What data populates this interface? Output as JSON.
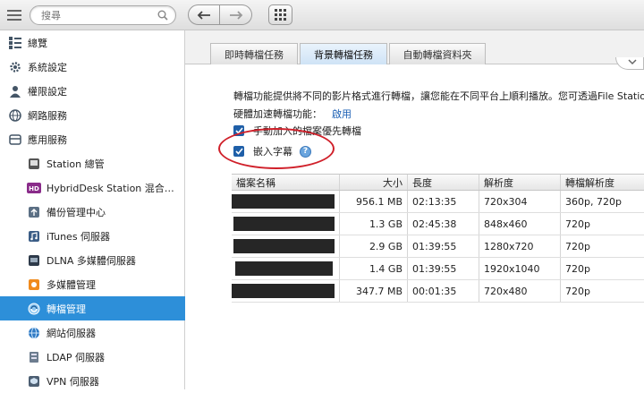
{
  "search": {
    "placeholder": "搜尋"
  },
  "sidebar": {
    "top_items": [
      {
        "label": "總覽",
        "icon": "overview-icon"
      },
      {
        "label": "系統設定",
        "icon": "gear-icon"
      },
      {
        "label": "權限設定",
        "icon": "user-icon"
      },
      {
        "label": "網路服務",
        "icon": "globe-icon"
      },
      {
        "label": "應用服務",
        "icon": "apps-icon"
      }
    ],
    "sub_items": [
      {
        "label": "Station 總管",
        "icon": "station-manager-icon"
      },
      {
        "label": "HybridDesk Station 混合…",
        "icon": "hd-icon"
      },
      {
        "label": "備份管理中心",
        "icon": "backup-icon"
      },
      {
        "label": "iTunes 伺服器",
        "icon": "itunes-icon"
      },
      {
        "label": "DLNA 多媒體伺服器",
        "icon": "dlna-icon"
      },
      {
        "label": "多媒體管理",
        "icon": "multimedia-icon"
      },
      {
        "label": "轉檔管理",
        "icon": "transcode-icon",
        "active": true
      },
      {
        "label": "網站伺服器",
        "icon": "web-server-icon"
      },
      {
        "label": "LDAP 伺服器",
        "icon": "ldap-icon"
      },
      {
        "label": "VPN 伺服器",
        "icon": "vpn-icon"
      }
    ]
  },
  "tabs": [
    {
      "label": "即時轉檔任務"
    },
    {
      "label": "背景轉檔任務",
      "active": true
    },
    {
      "label": "自動轉檔資料夾"
    }
  ],
  "content": {
    "description": "轉檔功能提供將不同的影片格式進行轉檔，讓您能在不同平台上順利播放。您可透過File Station",
    "hw_label": "硬體加速轉檔功能：",
    "hw_value": "啟用",
    "check1_label": "手動加入的檔案優先轉檔",
    "check2_label": "嵌入字幕",
    "help_glyph": "?"
  },
  "table": {
    "headers": {
      "name": "檔案名稱",
      "size": "大小",
      "length": "長度",
      "resolution": "解析度",
      "target": "轉檔解析度"
    },
    "rows": [
      {
        "size": "956.1 MB",
        "length": "02:13:35",
        "resolution": "720x304",
        "target": "360p, 720p"
      },
      {
        "size": "1.3 GB",
        "length": "02:45:38",
        "resolution": "848x460",
        "target": "720p"
      },
      {
        "size": "2.9 GB",
        "length": "01:39:55",
        "resolution": "1280x720",
        "target": "720p"
      },
      {
        "size": "1.4 GB",
        "length": "01:39:55",
        "resolution": "1920x1040",
        "target": "720p"
      },
      {
        "size": "347.7 MB",
        "length": "00:01:35",
        "resolution": "720x480",
        "target": "720p"
      }
    ]
  },
  "colors": {
    "active_sidebar": "#2d8fd9",
    "highlight_ellipse": "#d0202a",
    "checkbox": "#1f5fa8"
  }
}
